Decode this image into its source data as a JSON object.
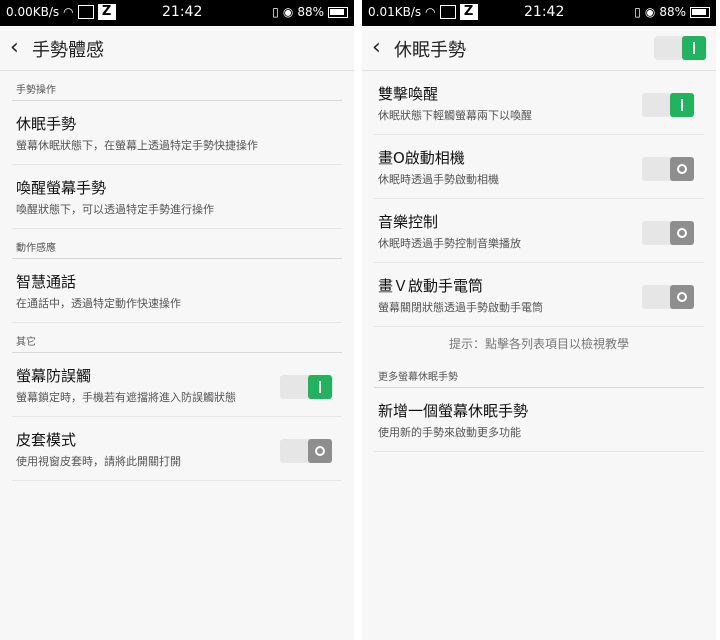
{
  "left": {
    "status": {
      "speed": "0.00KB/s",
      "time": "21:42",
      "battery": "88%"
    },
    "title": "手勢體感",
    "sections": [
      {
        "label": "手勢操作"
      },
      {
        "label": "動作感應"
      },
      {
        "label": "其它"
      }
    ],
    "items": [
      {
        "title": "休眠手勢",
        "subtitle": "螢幕休眠狀態下，在螢幕上透過特定手勢快捷操作"
      },
      {
        "title": "喚醒螢幕手勢",
        "subtitle": "喚醒狀態下，可以透過特定手勢進行操作"
      },
      {
        "title": "智慧通話",
        "subtitle": "在通話中，透過特定動作快速操作"
      },
      {
        "title": "螢幕防誤觸",
        "subtitle": "螢幕鎖定時，手機若有遮擋將進入防誤觸狀態",
        "toggle": "on"
      },
      {
        "title": "皮套模式",
        "subtitle": "使用視窗皮套時，請將此開關打開",
        "toggle": "off"
      }
    ]
  },
  "right": {
    "status": {
      "speed": "0.01KB/s",
      "time": "21:42",
      "battery": "88%"
    },
    "title": "休眠手勢",
    "header_toggle": "on",
    "items": [
      {
        "title": "雙擊喚醒",
        "subtitle": "休眠狀態下輕觸螢幕兩下以喚醒",
        "toggle": "on"
      },
      {
        "title": "畫O啟動相機",
        "subtitle": "休眠時透過手勢啟動相機",
        "toggle": "off"
      },
      {
        "title": "音樂控制",
        "subtitle": "休眠時透過手勢控制音樂播放",
        "toggle": "off"
      },
      {
        "title": "畫Ｖ啟動手電筒",
        "subtitle": "螢幕關閉狀態透過手勢啟動手電筒",
        "toggle": "off"
      }
    ],
    "hint": "提示：點擊各列表項目以檢視教學",
    "more_section": {
      "label": "更多螢幕休眠手勢"
    },
    "add_item": {
      "title": "新增一個螢幕休眠手勢",
      "subtitle": "使用新的手勢來啟動更多功能"
    }
  }
}
